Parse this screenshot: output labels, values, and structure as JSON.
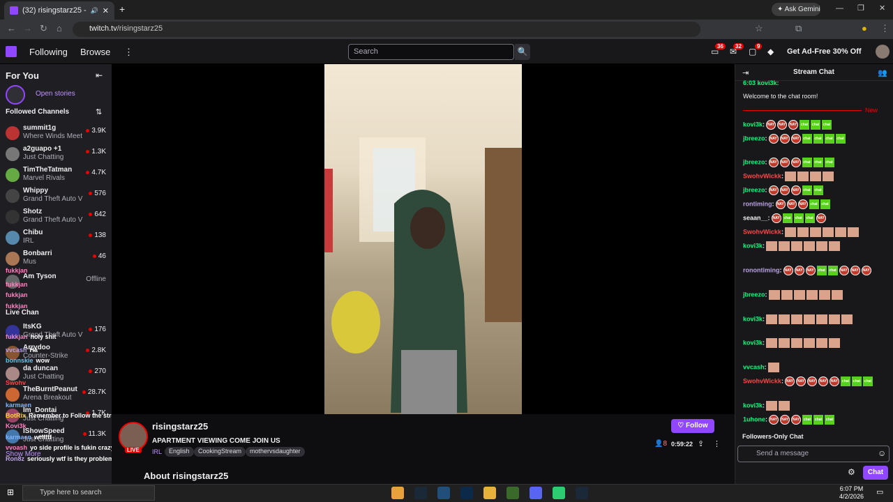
{
  "browser": {
    "tab_title": "(32) risingstarz25 - Twitch",
    "url_host": "twitch.tv",
    "url_path": "/risingstarz25",
    "ask_gemini": "Ask Gemini"
  },
  "topnav": {
    "following": "Following",
    "browse": "Browse",
    "search_placeholder": "Search",
    "badge_a": "36",
    "badge_b": "32",
    "badge_c": "9",
    "ad_free": "Get Ad-Free 30% Off"
  },
  "sidebar": {
    "for_you": "For You",
    "open_stories": "Open stories",
    "followed_channels": "Followed Channels",
    "channels": [
      {
        "name": "summit1g",
        "game": "Where Winds Meet",
        "viewers": "3.9K",
        "color": "#b33"
      },
      {
        "name": "a2guapo +1",
        "game": "Just Chatting",
        "viewers": "1.3K",
        "color": "#777"
      },
      {
        "name": "TimTheTatman",
        "game": "Marvel Rivals",
        "viewers": "4.7K",
        "color": "#6a4"
      },
      {
        "name": "Whippy",
        "game": "Grand Theft Auto V",
        "viewers": "576",
        "color": "#444"
      },
      {
        "name": "Shotz",
        "game": "Grand Theft Auto V",
        "viewers": "642",
        "color": "#333"
      },
      {
        "name": "Chibu",
        "game": "IRL",
        "viewers": "138",
        "color": "#58a"
      },
      {
        "name": "Bonbarri",
        "game": "Mus",
        "viewers": "46",
        "color": "#a75"
      },
      {
        "name": "Am   Tyson",
        "game": "",
        "viewers": "Offline",
        "color": "#666"
      },
      {
        "name": "Live Chan",
        "game": "",
        "viewers": "",
        "color": ""
      },
      {
        "name": "ItsKG",
        "game": "Grand Theft Auto V",
        "viewers": "176",
        "color": "#339"
      },
      {
        "name": "Arrydoo",
        "game": "Counter-Strike",
        "viewers": "2.8K",
        "color": "#853"
      },
      {
        "name": "da   duncan",
        "game": "Just Chatting",
        "viewers": "270",
        "color": "#a88"
      },
      {
        "name": "TheBurntPeanut",
        "game": "Arena Breakout",
        "viewers": "28.7K",
        "color": "#c63"
      },
      {
        "name": "Im_Dontai",
        "game": "Just Chatting",
        "viewers": "1.7K",
        "color": "#946"
      },
      {
        "name": "IShowSpeed",
        "game": "Just Chatting",
        "viewers": "11.3K",
        "color": "#47a"
      }
    ],
    "show_more": "Show More"
  },
  "overlay_chat": [
    {
      "user": "fukkjan",
      "text": "",
      "color": "#ff7fbf"
    },
    {
      "user": "fukkjan",
      "text": "",
      "color": "#ff7fbf"
    },
    {
      "user": "fukkjan",
      "text": "",
      "color": "#ff7fbf"
    },
    {
      "user": "fukkjan",
      "text": "",
      "color": "#ff7fbf"
    },
    {
      "user": "fukkjan",
      "text": "holy shit",
      "color": "#ff7fbf"
    },
    {
      "user": "vvcash",
      "text": "Ha",
      "color": "#b9a3e3"
    },
    {
      "user": "bonnskie",
      "text": "wow",
      "color": "#5bc8e8"
    },
    {
      "user": "Swohv",
      "text": "",
      "color": "#ff4545"
    },
    {
      "user": "karmaen",
      "text": "",
      "color": "#7fb2ff"
    },
    {
      "user": "BotRix",
      "text": "Remember to Follow the stream if you enjoy. 😁",
      "color": "#ffd23f"
    },
    {
      "user": "Kovi3k",
      "text": "",
      "color": "#ff7fbf"
    },
    {
      "user": "karmaen",
      "text": "wtfffff",
      "color": "#7fb2ff"
    },
    {
      "user": "vvoash",
      "text": "yo side profile is fukin crazy",
      "color": "#ff7fbf"
    },
    {
      "user": "Ron8z",
      "text": "seriously wtf is they problem",
      "color": "#b9a3e3"
    }
  ],
  "stream": {
    "channel": "risingstarz25",
    "live": "LIVE",
    "title": "APARTMENT VIEWING COME JOIN US",
    "category": "IRL",
    "tags": [
      "English",
      "CookingStream",
      "mothervsdaughter"
    ],
    "follow": "Follow",
    "viewers": "8",
    "uptime": "0:59:22",
    "about": "About risingstarz25"
  },
  "chat": {
    "header": "Stream Chat",
    "top_fragment": "6:03 kovi3k:",
    "welcome": "Welcome to the chat room!",
    "new_label": "New",
    "messages": [
      {
        "user": "kovi3k",
        "color": "#00ff7f",
        "emotes": "NNNggg"
      },
      {
        "user": "jbreezo",
        "color": "#00ff7f",
        "emotes": "NNNgggg"
      },
      {
        "user": "jbreezo",
        "color": "#00ff7f",
        "emotes": "NNNggg"
      },
      {
        "user": "SwohvWickk",
        "color": "#ff4545",
        "emotes": "ffff"
      },
      {
        "user": "jbreezo",
        "color": "#00ff7f",
        "emotes": "NNNgg"
      },
      {
        "user": "rontiming",
        "color": "#b9a3e3",
        "emotes": "NNNgg"
      },
      {
        "user": "seaan__",
        "color": "#efeff1",
        "emotes": "NgggN"
      },
      {
        "user": "SwohvWickk",
        "color": "#ff4545",
        "emotes": "ffffff"
      },
      {
        "user": "kovi3k",
        "color": "#00ff7f",
        "emotes": "ffffff"
      },
      {
        "user": "ronontiming",
        "color": "#b9a3e3",
        "emotes": "NNNggNNNgg"
      },
      {
        "user": "jbreezo",
        "color": "#00ff7f",
        "emotes": "ffffff"
      },
      {
        "user": "kovi3k",
        "color": "#00ff7f",
        "emotes": "fffffff"
      },
      {
        "user": "kovi3k",
        "color": "#00ff7f",
        "emotes": "ffffff"
      },
      {
        "user": "vvcash",
        "color": "#00ff7f",
        "emotes": "f"
      },
      {
        "user": "SwohvWickk",
        "color": "#ff4545",
        "emotes": "NNNNNgggg"
      },
      {
        "user": "kovi3k",
        "color": "#00ff7f",
        "emotes": "ff"
      },
      {
        "user": "1uhone",
        "color": "#00ff7f",
        "emotes": "NNNggg"
      }
    ],
    "followers_only": "Followers-Only Chat",
    "input_placeholder": "Send a message",
    "send": "Chat",
    "emote_nay": "NAY",
    "emote_chat": "chat"
  },
  "taskbar": {
    "search": "Type here to search",
    "time": "6:07 PM",
    "date": "4/2/2026"
  },
  "colors": {
    "accent": "#9146ff",
    "live_red": "#eb0400"
  }
}
